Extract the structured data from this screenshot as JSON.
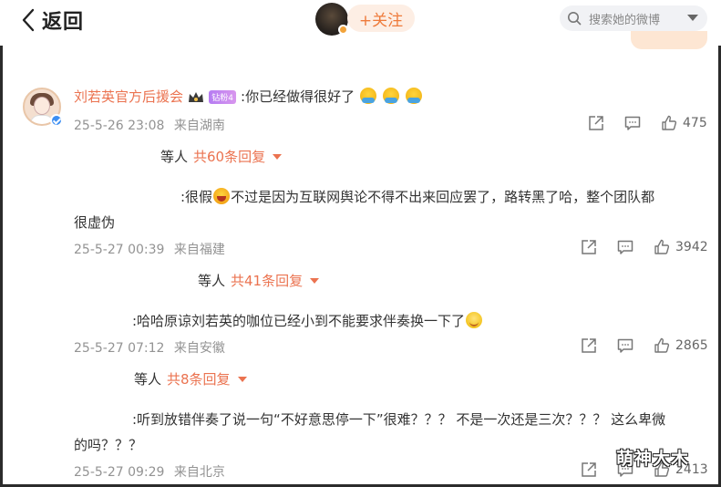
{
  "header": {
    "back_label": "返回",
    "follow_label": "+关注",
    "search_placeholder": "搜索她的微博"
  },
  "comments": [
    {
      "username": "刘若英官方后援会",
      "fan_badge": "钻粉4",
      "text": ":你已经做得很好了",
      "time": "25-5-26 23:08",
      "location": "来自湖南",
      "likes": "475",
      "reply_prefix": "等人",
      "reply_count": "共60条回复"
    },
    {
      "text_line1_a": ":很假",
      "text_line1_b": "不过是因为互联网舆论不得不出来回应罢了，路转黑了哈，整个团队都",
      "text_line2": "很虚伪",
      "time": "25-5-27 00:39",
      "location": "来自福建",
      "likes": "3942",
      "reply_prefix": "等人",
      "reply_count": "共41条回复"
    },
    {
      "text": ":哈哈原谅刘若英的咖位已经小到不能要求伴奏换一下了",
      "time": "25-5-27 07:12",
      "location": "来自安徽",
      "likes": "2865",
      "reply_prefix": "等人",
      "reply_count": "共8条回复"
    },
    {
      "text_line1": ":听到放错伴奏了说一句“不好意思停一下”很难？？？ 不是一次还是三次？？？ 这么卑微",
      "text_line2": "的吗？？？",
      "time": "25-5-27 09:29",
      "location": "来自北京",
      "likes": "2413"
    }
  ],
  "watermark": "萌神大木",
  "colors": {
    "accent": "#eb7350",
    "meta": "#939393",
    "verified": "#3d8ff3"
  }
}
